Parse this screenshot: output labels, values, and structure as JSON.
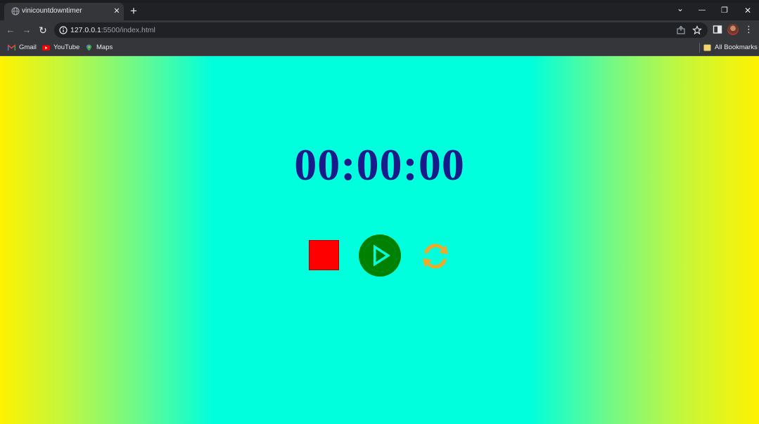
{
  "browser": {
    "tab": {
      "title": "vinicountdowntimer",
      "close_glyph": "✕"
    },
    "new_tab_glyph": "+",
    "window_controls": {
      "dropdown_glyph": "⌄",
      "minimize_glyph": "—",
      "restore_glyph": "❐",
      "close_glyph": "✕"
    },
    "nav": {
      "back_glyph": "←",
      "forward_glyph": "→",
      "reload_glyph": "↻"
    },
    "address_bar": {
      "host": "127.0.0.1",
      "path": ":5500/index.html"
    },
    "menu_glyph": "⋮",
    "bookmarks": [
      {
        "label": "Gmail",
        "icon": "gmail-icon",
        "color": "#ea4335"
      },
      {
        "label": "YouTube",
        "icon": "youtube-icon",
        "color": "#ff0000"
      },
      {
        "label": "Maps",
        "icon": "maps-icon",
        "color": "#34a853"
      }
    ],
    "all_bookmarks_label": "All Bookmarks"
  },
  "page": {
    "timer_display": "00:00:00",
    "controls": {
      "stop": {
        "icon": "stop-icon",
        "color": "#ff0000"
      },
      "play": {
        "icon": "play-icon",
        "color": "#008000"
      },
      "reset": {
        "icon": "refresh-icon",
        "color": "#f0a82a"
      }
    },
    "colors": {
      "background_edge": "#fff200",
      "background_center": "#00ffdc",
      "timer_text": "#1a1b8a"
    }
  }
}
